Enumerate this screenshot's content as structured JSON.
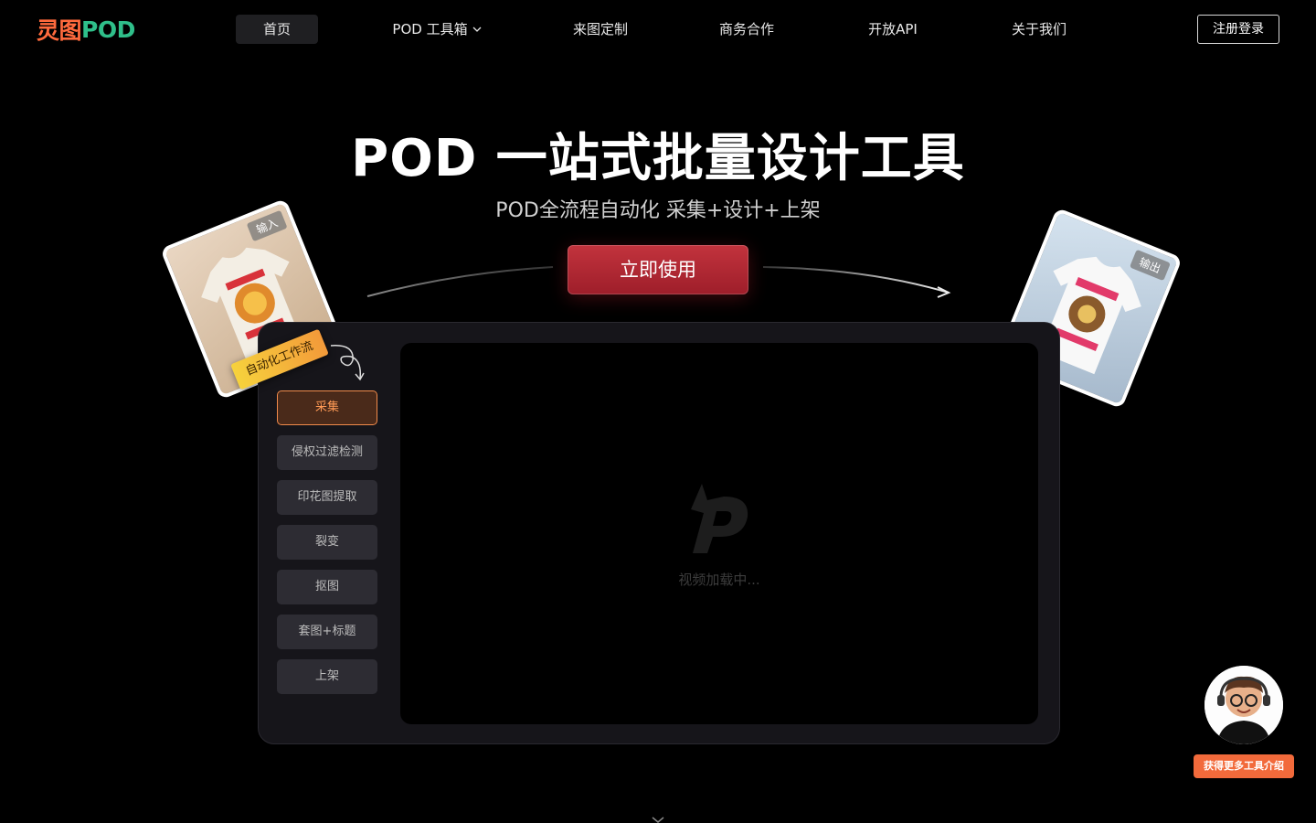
{
  "nav": {
    "logo_cn": "灵图",
    "logo_en": "POD",
    "items": [
      {
        "label": "首页",
        "active": true
      },
      {
        "label": "POD 工具箱",
        "dropdown": true
      },
      {
        "label": "来图定制"
      },
      {
        "label": "商务合作"
      },
      {
        "label": "开放API"
      },
      {
        "label": "关于我们"
      }
    ],
    "login_label": "注册登录"
  },
  "hero": {
    "title": "POD 一站式批量设计工具",
    "subtitle": "POD全流程自动化 采集+设计+上架",
    "cta_label": "立即使用"
  },
  "cards": {
    "input_tag": "输入",
    "output_tag": "输出",
    "workflow_tag": "自动化工作流"
  },
  "steps": [
    {
      "label": "采集",
      "active": true
    },
    {
      "label": "侵权过滤检测"
    },
    {
      "label": "印花图提取"
    },
    {
      "label": "裂变"
    },
    {
      "label": "抠图"
    },
    {
      "label": "套图+标题"
    },
    {
      "label": "上架"
    }
  ],
  "video": {
    "loading_text": "视频加载中..."
  },
  "assistant": {
    "button_label": "获得更多工具介绍"
  },
  "colors": {
    "brand_orange": "#ff6a3d",
    "brand_green": "#2fbf8a",
    "cta_red": "#b02832",
    "active_step": "#f08a4b"
  }
}
